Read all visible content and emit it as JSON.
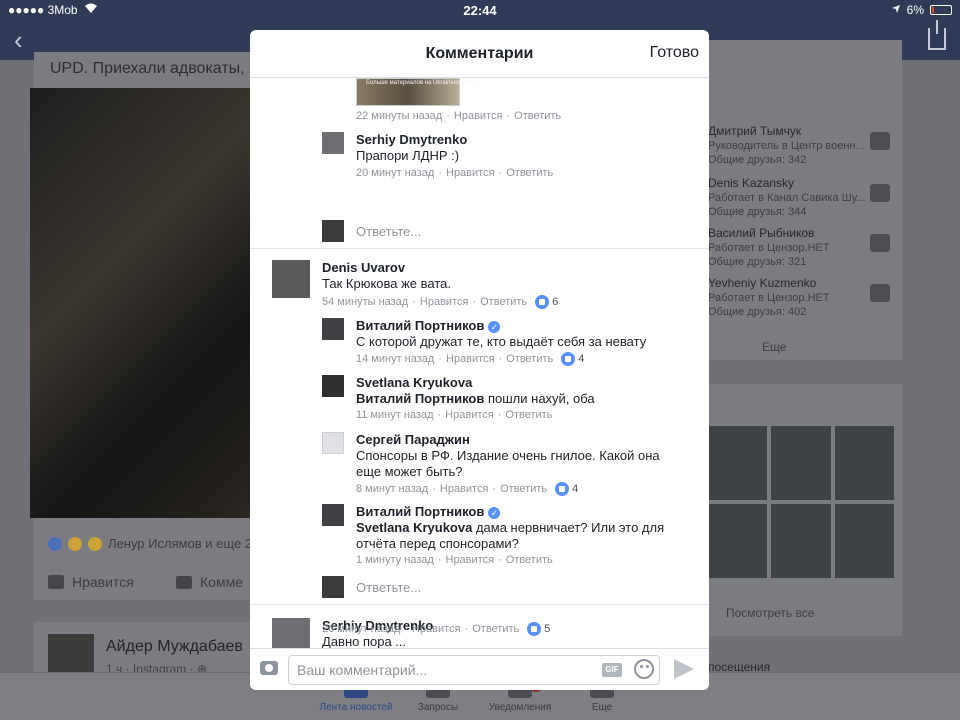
{
  "status": {
    "carrier": "●●●●● 3Mob",
    "time": "22:44",
    "battery": "6%"
  },
  "background": {
    "post_heading": "UPD. Приехали адвокаты, я",
    "reactions_text": "Ленур Ислямов и еще 2",
    "like_label": "Нравится",
    "comment_label": "Комме",
    "post2": {
      "author": "Айдер Муждабаев",
      "meta": "1 ч · Instagram · ⊕"
    },
    "friends": [
      {
        "name": "Дмитрий Тымчук",
        "sub": "Руководитель в Центр военн...",
        "mutual": "Общие друзья: 342"
      },
      {
        "name": "Denis Kazansky",
        "sub": "Работает в Канал Савика Шу...",
        "mutual": "Общие друзья: 344"
      },
      {
        "name": "Василий Рыбников",
        "sub": "Работает в Цензор.НЕТ",
        "mutual": "Общие друзья: 321"
      },
      {
        "name": "Yevheniy Kuzmenko",
        "sub": "Работает в Цензор.НЕТ",
        "mutual": "Общие друзья: 402"
      }
    ],
    "more_label": "Еще",
    "see_all_label": "Посмотреть все",
    "visits_label": "посещения",
    "tabs": [
      {
        "label": "Лента новостей"
      },
      {
        "label": "Запросы"
      },
      {
        "label": "Уведомления"
      },
      {
        "label": "Еще"
      }
    ]
  },
  "modal": {
    "title": "Комментарии",
    "done_label": "Готово",
    "thumb_caption": "Больше материалов на Ukraineex.com",
    "reply_placeholder": "Ответьте...",
    "like_action": "Нравится",
    "reply_action": "Ответить",
    "comments": [
      {
        "meta_time": "22 минуты назад"
      },
      {
        "name": "Serhiy Dmytrenko",
        "text": "Прапори ЛДНР :)",
        "meta_time": "20 минут назад"
      },
      {
        "name": "Denis Uvarov",
        "text": "Так Крюкова же вата.",
        "meta_time": "54 минуты назад",
        "likes": "6"
      },
      {
        "name": "Виталий Портников",
        "text": "С которой дружат те, кто выдаёт себя за невату",
        "meta_time": "14 минут назад",
        "likes": "4"
      },
      {
        "name": "Svetlana Kryukova",
        "mention": "Виталий Портников",
        "text": " пошли нахуй, оба",
        "meta_time": "11 минут назад"
      },
      {
        "name": "Сергей Параджин",
        "text": "Спонсоры в РФ. Издание очень гнилое. Какой она еще может быть?",
        "meta_time": "8 минут назад",
        "likes": "4"
      },
      {
        "name": "Виталий Портников",
        "mention": "Svetlana Kryukova",
        "text": " дама нервничает? Или это для отчёта перед спонсорами?",
        "meta_time": "1 минуту назад"
      },
      {
        "name": "Serhiy Dmytrenko",
        "text": "Давно пора ...",
        "meta_time": "26 минут назад",
        "likes": "5"
      }
    ],
    "composer": {
      "placeholder": "Ваш комментарий...",
      "gif_label": "GIF"
    },
    "colors": {
      "accent": "#5890ff",
      "nav": "#2f3b57"
    }
  }
}
